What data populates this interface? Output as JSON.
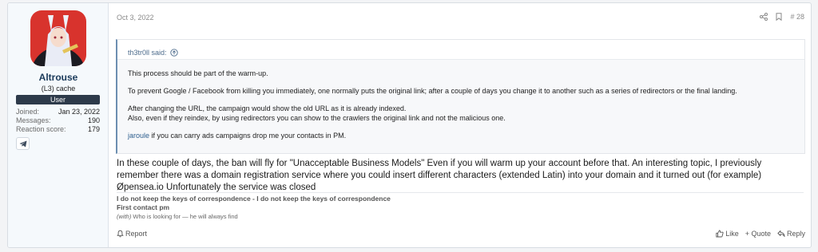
{
  "user": {
    "name": "Altrouse",
    "title": "(L3) cache",
    "banner": "User",
    "stats": [
      {
        "label": "Joined:",
        "value": "Jan 23, 2022"
      },
      {
        "label": "Messages:",
        "value": "190"
      },
      {
        "label": "Reaction score:",
        "value": "179"
      }
    ]
  },
  "post": {
    "date": "Oct 3, 2022",
    "number": "# 28",
    "quote": {
      "author": "th3tr0ll said:",
      "paragraphs": [
        "This process should be part of the warm-up.",
        "To prevent Google / Facebook from killing you immediately, one normally puts the original link; after a couple of days you change it to another such as a series of redirectors or the final landing.",
        "After changing the URL, the campaign would show the old URL as it is already indexed.",
        "Also, even if they reindex, by using redirectors you can show to the crawlers the original link and not the malicious one."
      ],
      "mention": "jaroule",
      "mention_text": " if you can carry ads campaigns drop me your contacts in PM."
    },
    "message": "In these couple of days, the ban will fly for \"Unacceptable Business Models\" Even if you will warm up your account before that. An interesting topic, I previously remember there was a domain registration service where you could insert different characters (extended Latin) into your domain and it turned out (for example) Øpensea.io Unfortunately the service was closed",
    "signature": {
      "line1": "I do not keep the keys of correspondence - I do not keep the keys of correspondence",
      "line2": "First contact pm",
      "small_em": "(with)",
      "small_text": " Who is looking for — he will always find"
    }
  },
  "footer": {
    "report": "Report",
    "like": "Like",
    "quote": "+ Quote",
    "reply": "Reply"
  },
  "icons": {
    "share": "share-icon",
    "bookmark": "bookmark-icon",
    "telegram": "telegram-icon",
    "report": "bell-icon",
    "like": "thumbs-up-icon",
    "reply": "reply-icon"
  },
  "colors": {
    "banner": "#2d3a4a",
    "quote_border": "#6d8fb1",
    "link": "#2f5f8f"
  }
}
